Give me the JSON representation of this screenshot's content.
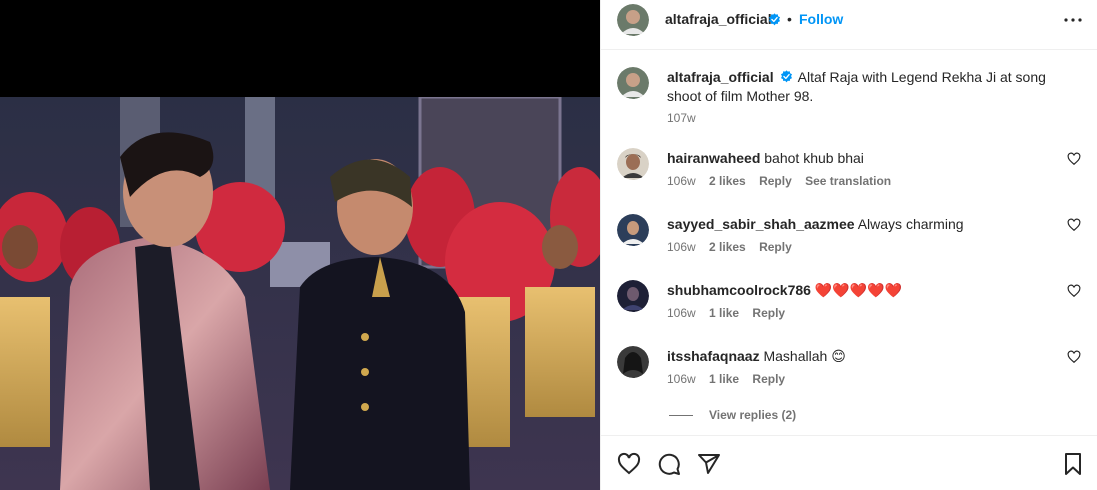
{
  "post": {
    "username": "altafraja_official",
    "follow_label": "Follow",
    "dot": "•",
    "caption": "Altaf Raja with Legend Rekha Ji at song shoot of film Mother 98.",
    "caption_time": "107w"
  },
  "comments": [
    {
      "user": "hairanwaheed",
      "text": "bahot khub bhai",
      "time": "106w",
      "likes": "2 likes",
      "reply": "Reply",
      "translate": "See translation"
    },
    {
      "user": "sayyed_sabir_shah_aazmee",
      "text": "Always charming",
      "time": "106w",
      "likes": "2 likes",
      "reply": "Reply"
    },
    {
      "user": "shubhamcoolrock786",
      "text": "❤️❤️❤️❤️❤️",
      "time": "106w",
      "likes": "1 like",
      "reply": "Reply"
    },
    {
      "user": "itsshafaqnaaz",
      "text": "Mashallah 😊",
      "time": "106w",
      "likes": "1 like",
      "reply": "Reply"
    }
  ],
  "view_replies": "View replies (2)",
  "icons": {
    "header_more": "more-options-icon",
    "like": "heart-icon",
    "comment": "comment-icon",
    "share": "share-icon",
    "save": "bookmark-icon",
    "verified": "verified-badge-icon"
  },
  "colors": {
    "accent": "#0095f6",
    "text": "#262626",
    "muted": "#737373",
    "border": "#efefef"
  }
}
